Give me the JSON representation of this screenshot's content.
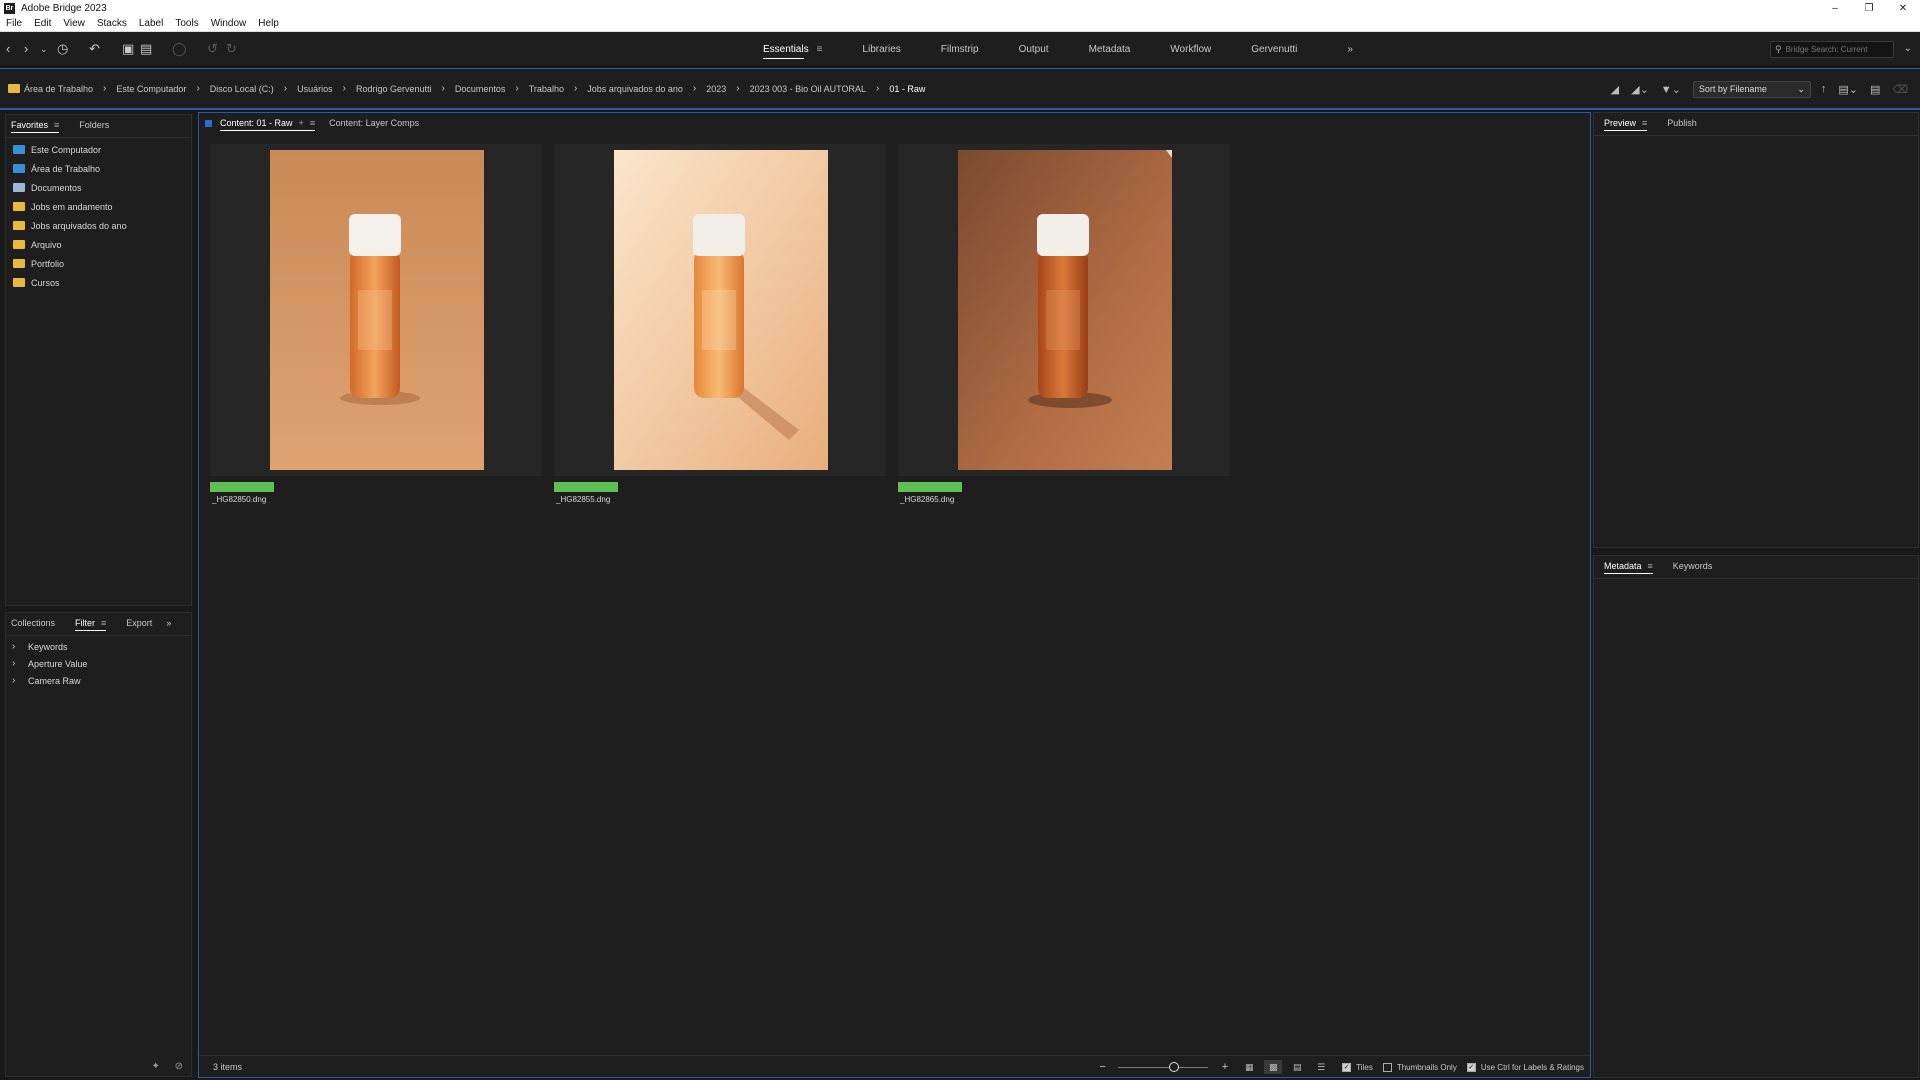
{
  "window": {
    "title": "Adobe Bridge 2023",
    "app_icon": "Br",
    "controls": [
      "minimize-icon",
      "restore-icon",
      "close-icon"
    ]
  },
  "menu": [
    "File",
    "Edit",
    "View",
    "Stacks",
    "Label",
    "Tools",
    "Window",
    "Help"
  ],
  "toolbar": {
    "workspaces": [
      "Essentials",
      "Libraries",
      "Filmstrip",
      "Output",
      "Metadata",
      "Workflow",
      "Gervenutti"
    ],
    "active_workspace": "Essentials",
    "more": "»",
    "search_placeholder": "Bridge Search: Current"
  },
  "path": {
    "crumbs": [
      "Área de Trabalho",
      "Este Computador",
      "Disco Local (C:)",
      "Usuários",
      "Rodrigo Gervenutti",
      "Documentos",
      "Trabalho",
      "Jobs arquivados do ano",
      "2023",
      "2023 003 - Bio Oil AUTORAL",
      "01 - Raw"
    ],
    "sort_label": "Sort by Filename"
  },
  "favorites_panel": {
    "tabs": [
      "Favorites",
      "Folders"
    ],
    "items": [
      {
        "label": "Este Computador",
        "icon": "computer-icon"
      },
      {
        "label": "Área de Trabalho",
        "icon": "desktop-icon"
      },
      {
        "label": "Documentos",
        "icon": "documents-icon"
      },
      {
        "label": "Jobs em andamento",
        "icon": "folder-icon"
      },
      {
        "label": "Jobs arquivados do ano",
        "icon": "folder-icon"
      },
      {
        "label": "Arquivo",
        "icon": "folder-icon"
      },
      {
        "label": "Portfolio",
        "icon": "folder-icon"
      },
      {
        "label": "Cursos",
        "icon": "folder-icon"
      }
    ]
  },
  "filter_panel": {
    "tabs": [
      "Collections",
      "Filter",
      "Export"
    ],
    "more": "»",
    "items": [
      "Keywords",
      "Aperture Value",
      "Camera Raw"
    ]
  },
  "content_panel": {
    "tabs": [
      "Content: 01 - Raw",
      "Content: Layer Comps"
    ],
    "add": "+",
    "thumbnails": [
      {
        "filename": "_HG82850.dng",
        "label_color": "#5fbf53"
      },
      {
        "filename": "_HG82855.dng",
        "label_color": "#5fbf53"
      },
      {
        "filename": "_HG82865.dng",
        "label_color": "#5fbf53"
      }
    ],
    "item_count": "3 items",
    "zoom_level": 0.62,
    "options": {
      "tiles": "Tiles",
      "thumbnails_only": "Thumbnails Only",
      "use_ctrl": "Use Ctrl for Labels & Ratings"
    }
  },
  "preview_panel": {
    "tabs": [
      "Preview",
      "Publish"
    ]
  },
  "metadata_panel": {
    "tabs": [
      "Metadata",
      "Keywords"
    ]
  },
  "colors": {
    "accent": "#2a5ba8",
    "label_green": "#5fbf53",
    "folder": "#e8b93c",
    "background": "#1a1a1a"
  }
}
